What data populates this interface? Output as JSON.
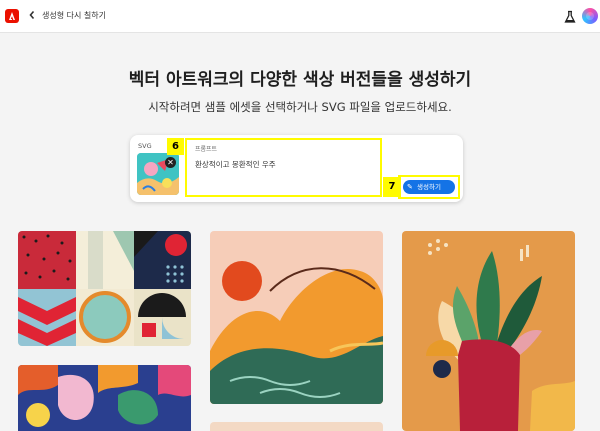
{
  "header": {
    "title": "생성형 다시 칠하기",
    "back_icon": "chevron-left-icon",
    "logo_icon": "adobe-logo-icon",
    "labs_icon": "flask-icon",
    "avatar": "user-avatar"
  },
  "hero": {
    "title": "벡터 아트워크의 다양한 색상 버전들을 생성하기",
    "subtitle": "시작하려면 샘플 에셋을 선택하거나 SVG 파일을 업로드하세요."
  },
  "prompt_card": {
    "file_type": "SVG",
    "remove_icon": "close-icon",
    "prompt_label": "프롬프트",
    "prompt_value": "환상적이고 몽환적인 우주",
    "generate_label": "생성하기",
    "generate_icon": "sparkle-edit-icon",
    "annotation_prompt": "6",
    "annotation_generate": "7"
  },
  "colors": {
    "accent": "#1473e6",
    "adobe_red": "#eb1000",
    "annotation": "#fffb00",
    "background": "#f4f4f4"
  },
  "gallery": [
    {
      "name": "geometric-pattern"
    },
    {
      "name": "sunset-mountains"
    },
    {
      "name": "plant-vase"
    },
    {
      "name": "abstract-leaves"
    },
    {
      "name": "more-artwork"
    }
  ]
}
